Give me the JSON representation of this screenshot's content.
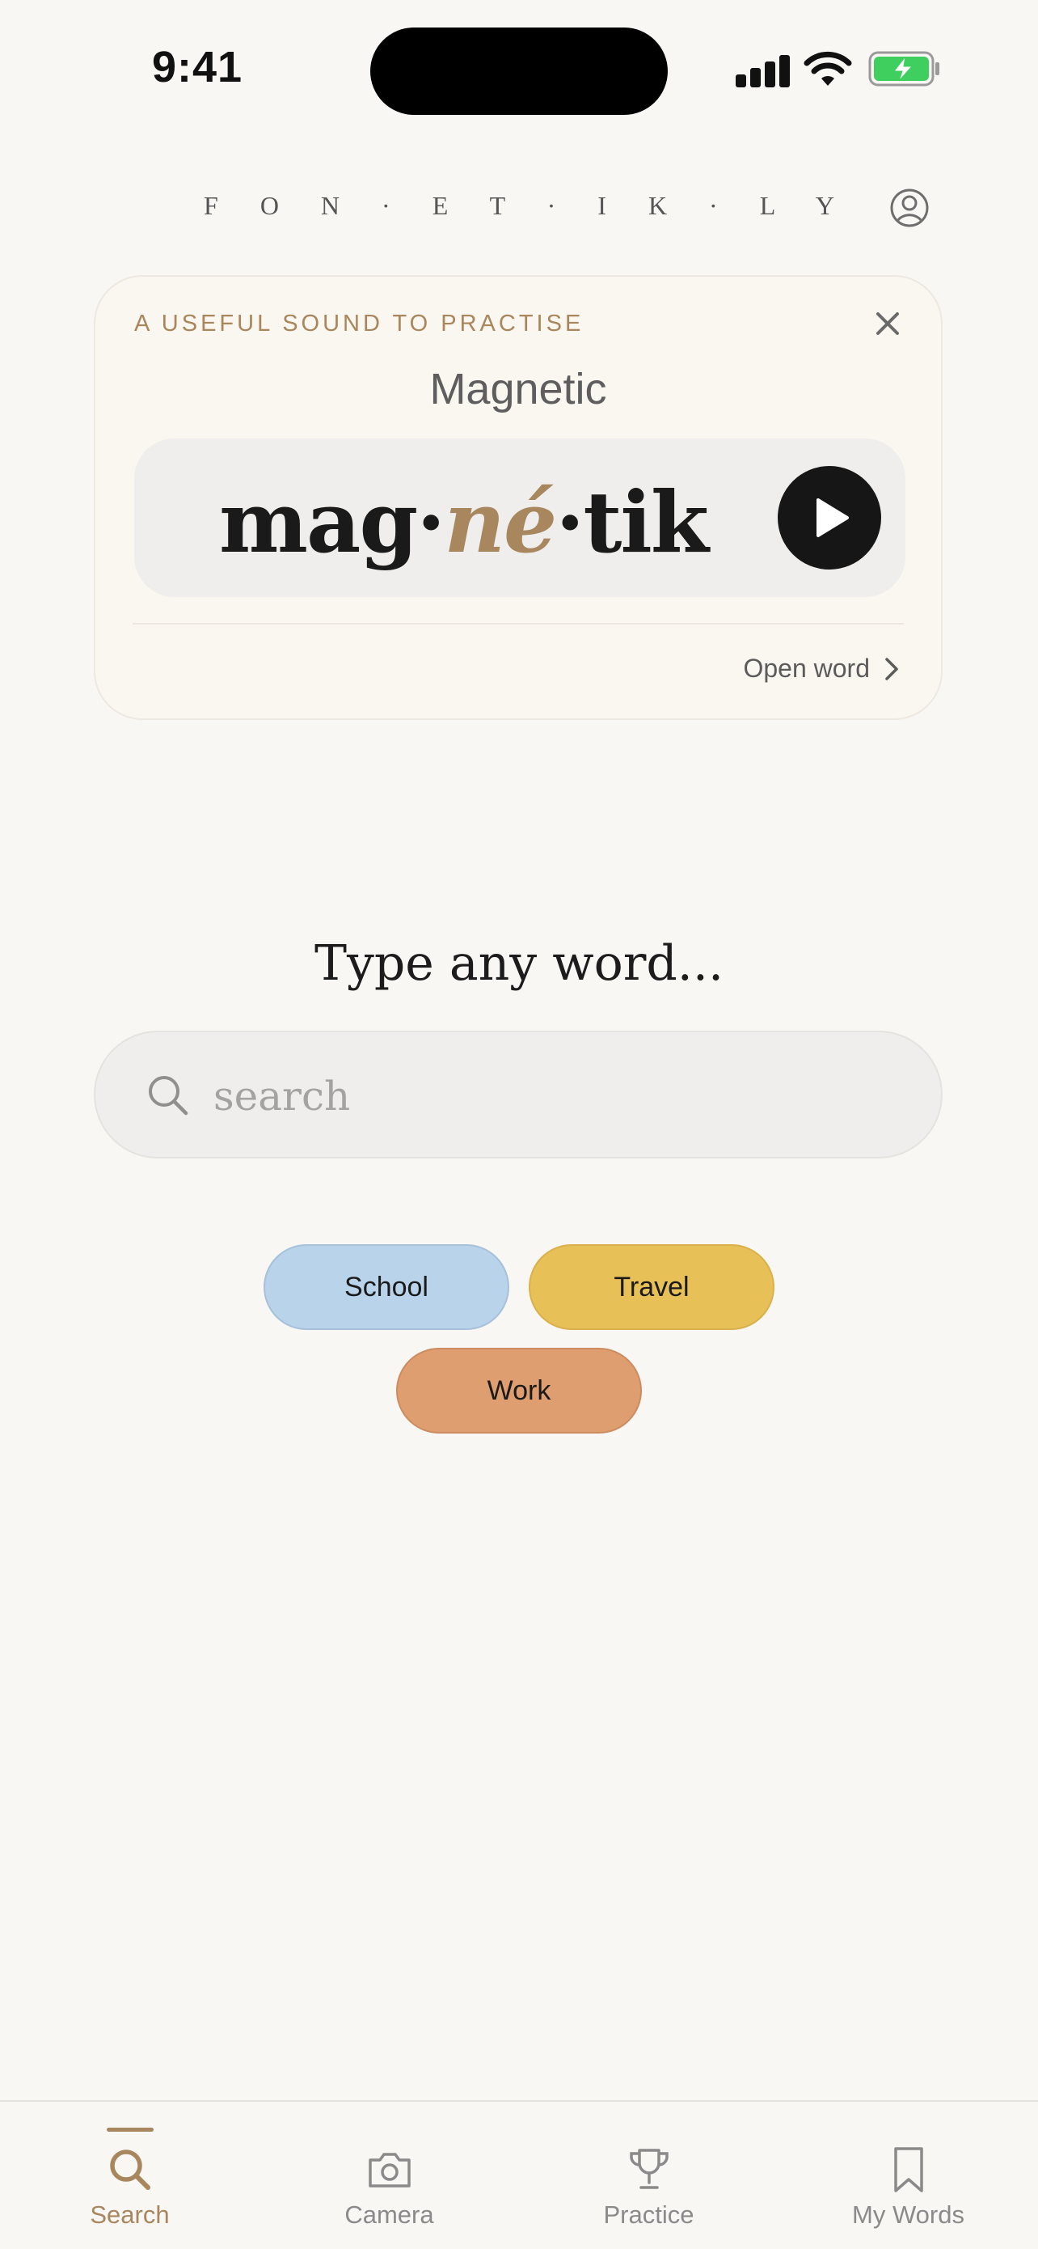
{
  "status_bar": {
    "time": "9:41"
  },
  "header": {
    "brand": "F O N · E T · I K · L Y",
    "profile_icon": "user-circle-icon"
  },
  "sound_card": {
    "eyebrow": "A USEFUL SOUND TO PRACTISE",
    "word": "Magnetic",
    "phonetic_before": "mag·",
    "phonetic_stress": "né",
    "phonetic_after": "·tik",
    "open_word_label": "Open word",
    "colors": {
      "stress": "#a8875f",
      "play_bg": "#161616"
    }
  },
  "search": {
    "prompt": "Type any word...",
    "placeholder": "search",
    "value": ""
  },
  "chips": [
    {
      "label": "School",
      "color": "#b8d3ea"
    },
    {
      "label": "Travel",
      "color": "#e8c058"
    },
    {
      "label": "Work",
      "color": "#df9e70"
    }
  ],
  "tabbar": {
    "active": "Search",
    "tabs": [
      {
        "label": "Search",
        "icon": "search-icon"
      },
      {
        "label": "Camera",
        "icon": "camera-icon"
      },
      {
        "label": "Practice",
        "icon": "trophy-icon"
      },
      {
        "label": "My Words",
        "icon": "bookmark-icon"
      }
    ]
  }
}
